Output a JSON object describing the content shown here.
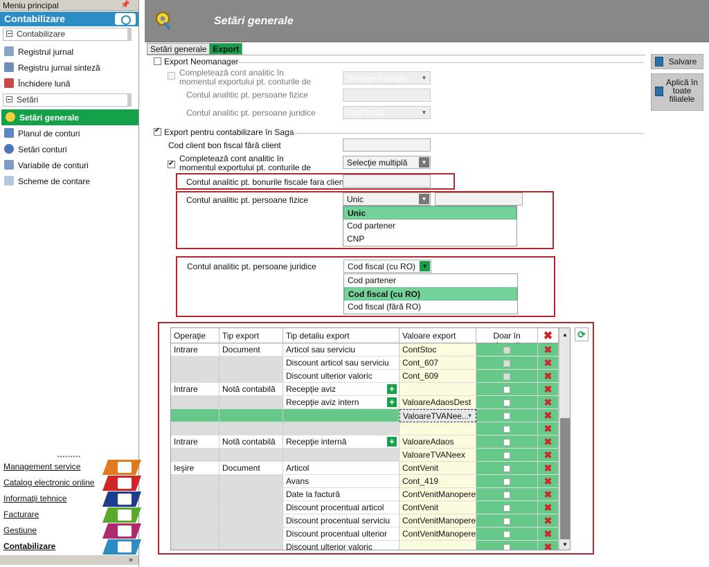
{
  "sidebar": {
    "header": "Meniu principal",
    "title": "Contabilizare",
    "group1": "Contabilizare",
    "items1": [
      {
        "label": "Registrul jurnal",
        "icon": "journal-icon"
      },
      {
        "label": "Registru jurnal sinteză",
        "icon": "journal-synthesis-icon"
      },
      {
        "label": "Închidere lună",
        "icon": "month-close-icon"
      }
    ],
    "group2": "Setări",
    "items2": [
      {
        "label": "Setări generale",
        "icon": "settings-gear-icon"
      },
      {
        "label": "Planul de conturi",
        "icon": "chart-of-accounts-icon"
      },
      {
        "label": "Setări conturi",
        "icon": "account-settings-icon"
      },
      {
        "label": "Variabile de conturi",
        "icon": "account-variables-icon"
      },
      {
        "label": "Scheme de contare",
        "icon": "accounting-schemes-icon"
      }
    ],
    "modules": [
      {
        "label": "Management service",
        "color": "#e07a1e"
      },
      {
        "label": "Catalog electronic online",
        "color": "#d0262a"
      },
      {
        "label": "Informaţii tehnice",
        "color": "#1e3c8c"
      },
      {
        "label": "Facturare",
        "color": "#5aa82a"
      },
      {
        "label": "Gestiune",
        "color": "#b0286e"
      },
      {
        "label": "Contabilizare",
        "color": "#2b8dc4"
      }
    ],
    "footer": "»"
  },
  "header": {
    "title": "Setări generale"
  },
  "tabs": [
    "Setări generale",
    "Export"
  ],
  "neo": {
    "label": "Export Neomanager",
    "analytic_label": "Completează cont analitic în momentul exportului pt. conturile de",
    "analytic_value": "Selecţie multiplă",
    "pf_label": "Contul analitic pt. persoane fizice",
    "pj_label": "Contul analitic pt. persoane juridice",
    "pj_value": "Cod fiscal"
  },
  "saga": {
    "label": "Export pentru contabilizare în Saga",
    "client_label": "Cod client bon fiscal fără client",
    "analytic_label": "Completează cont analitic în momentul exportului pt. conturile de",
    "analytic_value": "Selecţie multiplă",
    "bonuri_label": "Contul analitic pt. bonurile fiscale fara client",
    "pf_label": "Contul analitic pt. persoane fizice",
    "pf_value": "Unic",
    "pf_options": [
      "Unic",
      "Cod partener",
      "CNP"
    ],
    "pj_label": "Contul analitic pt. persoane juridice",
    "pj_value": "Cod fiscal (cu RO)",
    "pj_options": [
      "Cod partener",
      "Cod fiscal (cu RO)",
      "Cod fiscal (fără RO)"
    ]
  },
  "table": {
    "headers": [
      "Operaţie",
      "Tip export",
      "Tip detaliu export",
      "Valoare export",
      "Doar în depozit"
    ],
    "rows": [
      {
        "op": "Intrare",
        "tip": "Document",
        "det": "Articol sau serviciu",
        "val": "ContStoc",
        "plus": false
      },
      {
        "op": "",
        "tip": "",
        "det": "Discount articol sau serviciu",
        "val": "Cont_607",
        "plus": false
      },
      {
        "op": "",
        "tip": "",
        "det": "Discount ulterior valoric",
        "val": "Cont_609",
        "plus": false
      },
      {
        "op": "Intrare",
        "tip": "Notă contabilă",
        "det": "Recepţie aviz",
        "val": "",
        "plus": true
      },
      {
        "op": "",
        "tip": "",
        "det": "Recepţie aviz intern",
        "val": "ValoareAdaosDest",
        "plus": true
      },
      {
        "op": "",
        "tip": "",
        "det": "",
        "val": "ValoareTVANee...",
        "plus": false
      },
      {
        "op": "",
        "tip": "",
        "det": "",
        "val": "",
        "plus": false
      },
      {
        "op": "Intrare",
        "tip": "Notă contabilă",
        "det": "Recepţie internă",
        "val": "ValoareAdaos",
        "plus": true
      },
      {
        "op": "",
        "tip": "",
        "det": "",
        "val": "ValoareTVANeex",
        "plus": false
      },
      {
        "op": "Ieşire",
        "tip": "Document",
        "det": "Articol",
        "val": "ContVenit",
        "plus": false
      },
      {
        "op": "",
        "tip": "",
        "det": "Avans",
        "val": "Cont_419",
        "plus": false
      },
      {
        "op": "",
        "tip": "",
        "det": "Date la factură",
        "val": "ContVenitManopere",
        "plus": false
      },
      {
        "op": "",
        "tip": "",
        "det": "Discount procentual articol",
        "val": "ContVenit",
        "plus": false
      },
      {
        "op": "",
        "tip": "",
        "det": "Discount procentual serviciu",
        "val": "ContVenitManopere",
        "plus": false
      },
      {
        "op": "",
        "tip": "",
        "det": "Discount procentual ulterior",
        "val": "ContVenitManopere",
        "plus": false
      },
      {
        "op": "",
        "tip": "",
        "det": "Discount ulterior valoric",
        "val": "",
        "plus": false
      }
    ]
  },
  "buttons": {
    "save": "Salvare",
    "apply_all": "Aplică în toate filialele"
  }
}
